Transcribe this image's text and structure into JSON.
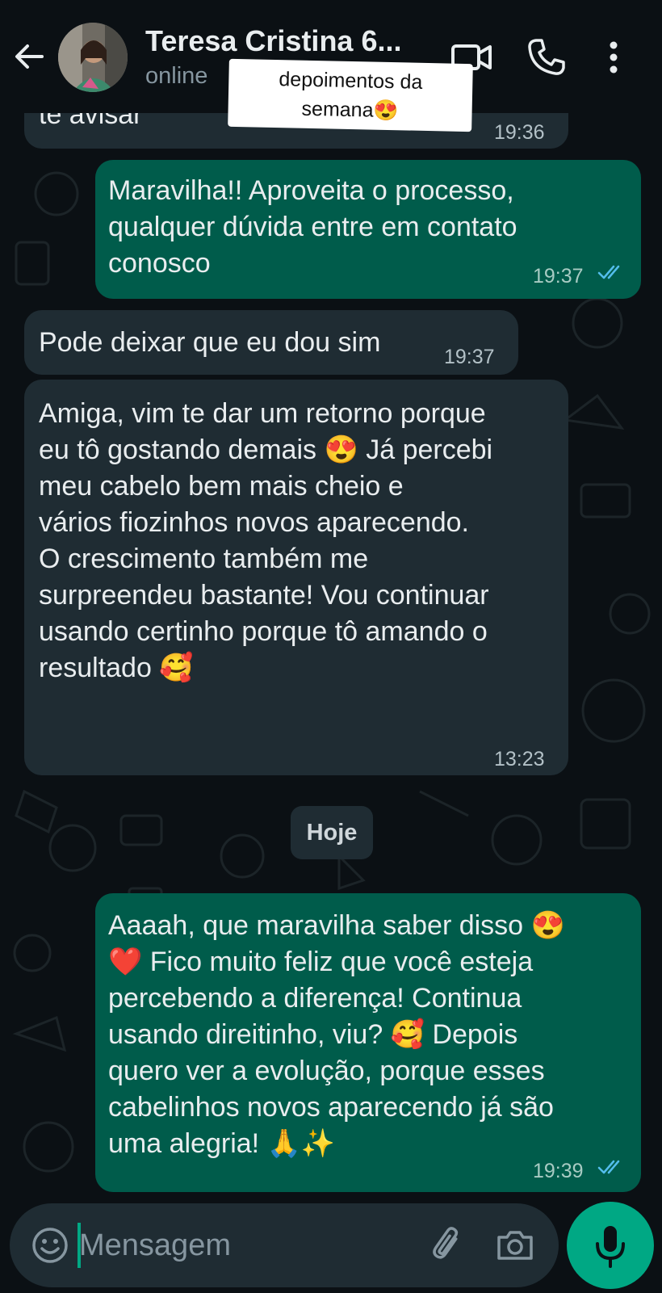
{
  "header": {
    "contact_name": "Teresa Cristina 6...",
    "status": "online",
    "sticker_line1": "depoimentos da",
    "sticker_line2": "semana😍"
  },
  "messages": [
    {
      "direction": "incoming",
      "text": "te avisar",
      "time": "19:36"
    },
    {
      "direction": "outgoing",
      "text": "Maravilha!! Aproveita o  processo,\nqualquer dúvida entre em contato\nconosco",
      "time": "19:37",
      "status": "read"
    },
    {
      "direction": "incoming",
      "text": "Pode deixar que eu dou sim",
      "time": "19:37"
    },
    {
      "direction": "incoming",
      "text": "Amiga, vim te dar um retorno porque\neu tô gostando demais 😍 Já percebi\nmeu cabelo bem mais cheio e\nvários fiozinhos novos aparecendo.\nO crescimento também me\nsurpreendeu bastante! Vou continuar\nusando certinho porque tô amando o\nresultado 🥰",
      "time": "13:23"
    },
    {
      "direction": "outgoing",
      "text": "Aaaah, que maravilha saber disso 😍\n❤️ Fico muito feliz que você esteja\npercebendo a diferença! Continua\nusando direitinho, viu? 🥰 Depois\nquero ver a evolução, porque esses\ncabelinhos novos aparecendo já são\numa alegria! 🙏✨",
      "time": "19:39",
      "status": "read"
    }
  ],
  "day_separator": "Hoje",
  "composer": {
    "placeholder": "Mensagem"
  },
  "icons": [
    "back-arrow-icon",
    "video-call-icon",
    "phone-icon",
    "more-vertical-icon",
    "emoji-icon",
    "attach-icon",
    "camera-icon",
    "mic-icon",
    "double-check-icon"
  ],
  "colors": {
    "background": "#0b1014",
    "incoming_bubble": "#1f2c33",
    "outgoing_bubble": "#005c4b",
    "accent": "#00a884",
    "read_ticks": "#53bdeb"
  }
}
